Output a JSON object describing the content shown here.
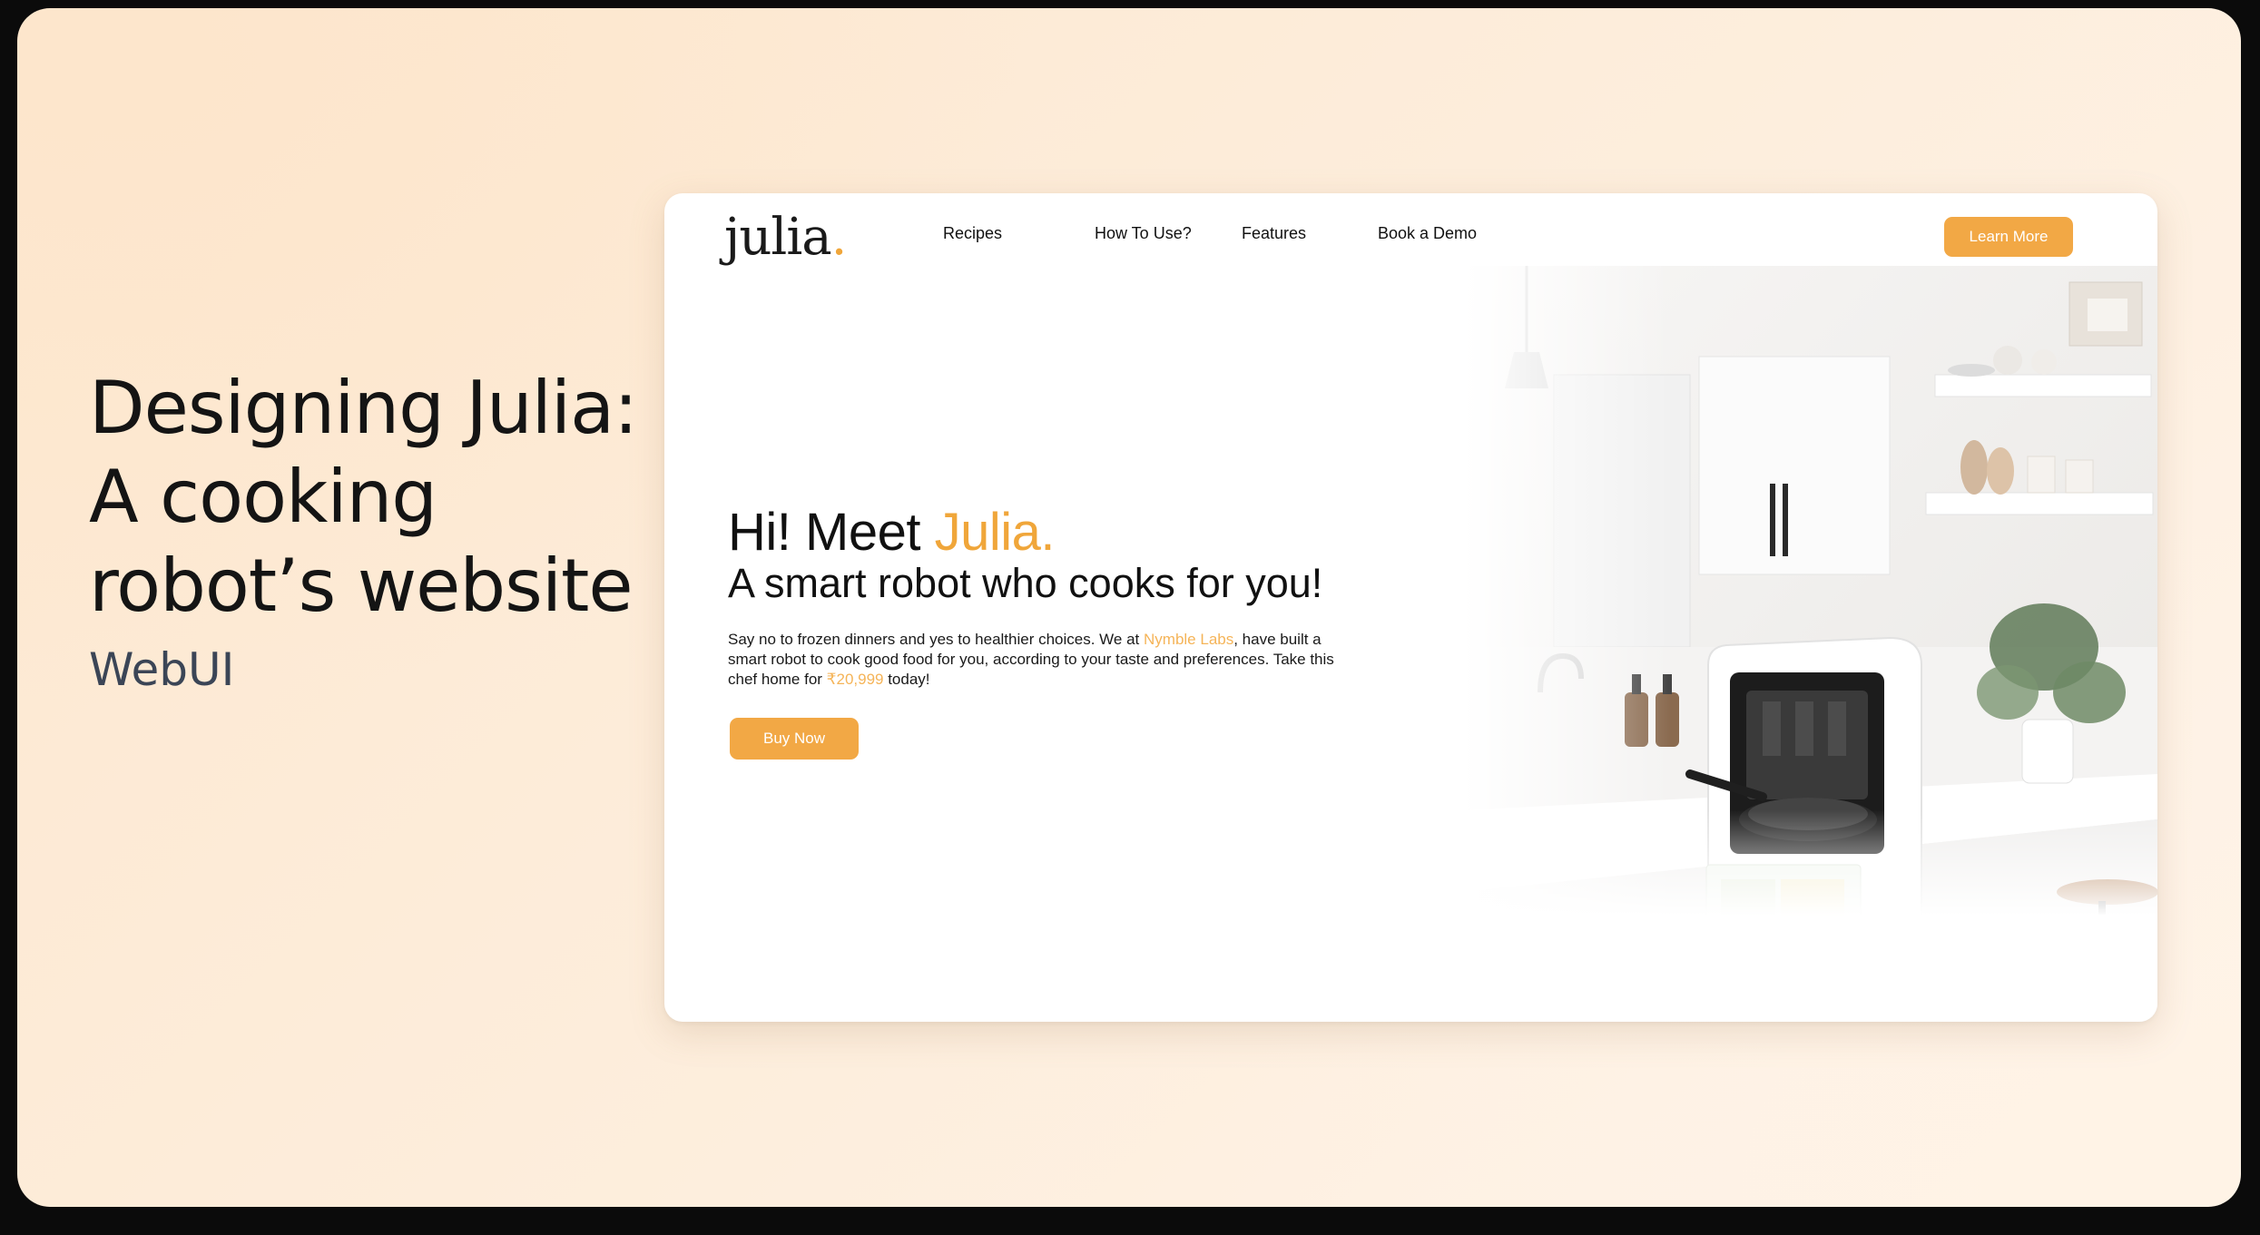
{
  "presentation": {
    "title": "Designing Julia: A cooking robot’s website",
    "tag": "WebUI"
  },
  "site": {
    "logo": {
      "text": "julia",
      "dot": "."
    },
    "nav": [
      {
        "label": "Recipes"
      },
      {
        "label": "How To Use?"
      },
      {
        "label": "Features"
      },
      {
        "label": "Book a Demo"
      }
    ],
    "cta_label": "Learn More",
    "hero": {
      "greeting": "Hi! Meet ",
      "name": "Julia.",
      "subtitle": "A smart robot who cooks for you!",
      "body_1": "Say no to frozen dinners and yes to healthier choices. We at ",
      "company": "Nymble Labs",
      "body_2": ", have built a smart robot to cook good food for you, according to your taste and preferences. Take this chef home for ",
      "price": "₹20,999",
      "body_3": " today!",
      "button_label": "Buy Now"
    }
  },
  "colors": {
    "accent": "#f2a845",
    "background": "#fde7cf",
    "text": "#141414"
  }
}
